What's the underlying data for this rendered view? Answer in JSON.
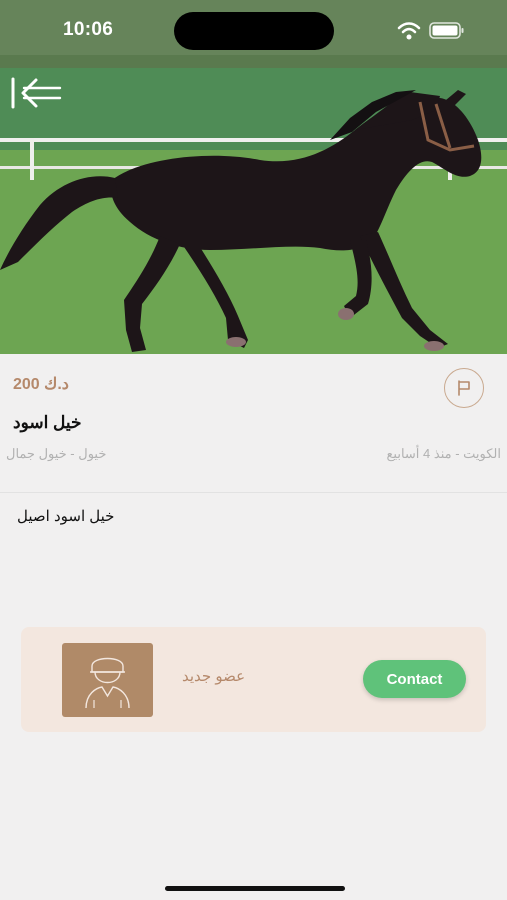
{
  "status_bar": {
    "time": "10:06",
    "icons": [
      "wifi-icon",
      "battery-icon"
    ]
  },
  "listing": {
    "image": "black-horse-photo",
    "price": "د.ك 200",
    "title": "خيل اسود",
    "category": "خيول - خيول جمال",
    "location_time": "الكويت - منذ 4 أسابيع",
    "description": "خيل اسود اصيل"
  },
  "seller": {
    "member_label": "عضو جديد",
    "contact_label": "Contact",
    "avatar_icon": "user-avatar-icon"
  },
  "icons": {
    "back": "back-arrow-icon",
    "report": "flag-icon"
  },
  "colors": {
    "accent": "#b5896b",
    "contact": "#5fc27a",
    "card_background": "#f3e7df",
    "avatar_background": "#b08a68",
    "page_background": "#f1f0f0"
  }
}
